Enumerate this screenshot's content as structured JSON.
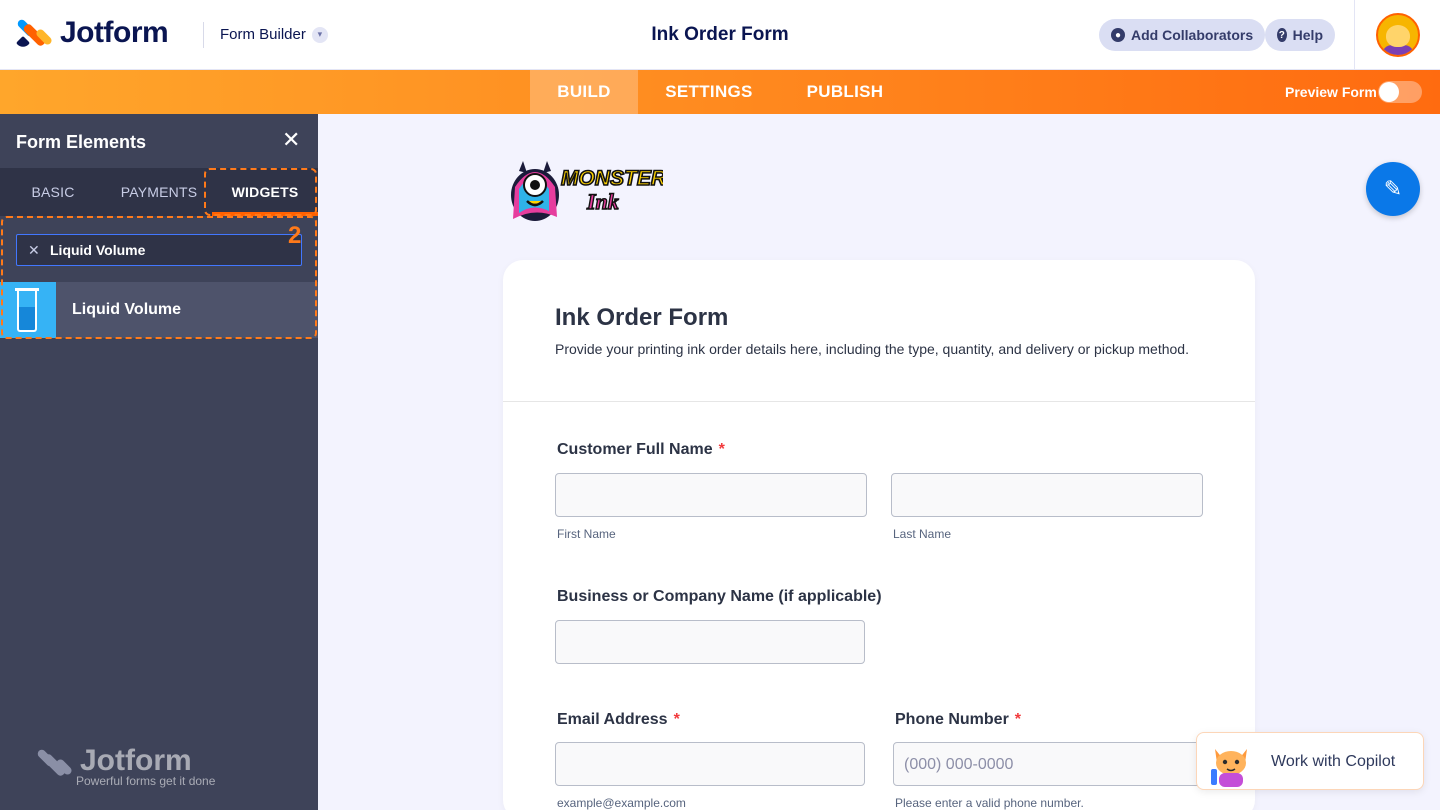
{
  "header": {
    "brand": "Jotform",
    "builder_label": "Form Builder",
    "form_title": "Ink Order Form",
    "add_collaborators": "Add Collaborators",
    "help": "Help"
  },
  "nav": {
    "tabs": [
      "BUILD",
      "SETTINGS",
      "PUBLISH"
    ],
    "active_tab": "BUILD",
    "preview_label": "Preview Form",
    "preview_on": false
  },
  "sidebar": {
    "title": "Form Elements",
    "tabs": [
      "BASIC",
      "PAYMENTS",
      "WIDGETS"
    ],
    "active_tab": "WIDGETS",
    "search_value": "Liquid Volume",
    "step_marker": "2",
    "results": [
      {
        "label": "Liquid Volume",
        "icon": "beaker-icon"
      }
    ],
    "footer_brand": "Jotform",
    "footer_tagline": "Powerful forms get it done"
  },
  "form": {
    "title": "Ink Order Form",
    "description": "Provide your printing ink order details here, including the type, quantity, and delivery or pickup method.",
    "fields": {
      "name_label": "Customer Full Name",
      "first_name_sub": "First Name",
      "last_name_sub": "Last Name",
      "company_label": "Business or Company Name (if applicable)",
      "email_label": "Email Address",
      "email_sub": "example@example.com",
      "phone_label": "Phone Number",
      "phone_placeholder": "(000) 000-0000",
      "phone_sub": "Please enter a valid phone number."
    },
    "required_mark": "*"
  },
  "copilot": {
    "label": "Work with Copilot"
  },
  "colors": {
    "accent": "#ff6100",
    "navy": "#0a1551",
    "sidebar": "#3e4359",
    "link_blue": "#0a78e8"
  }
}
